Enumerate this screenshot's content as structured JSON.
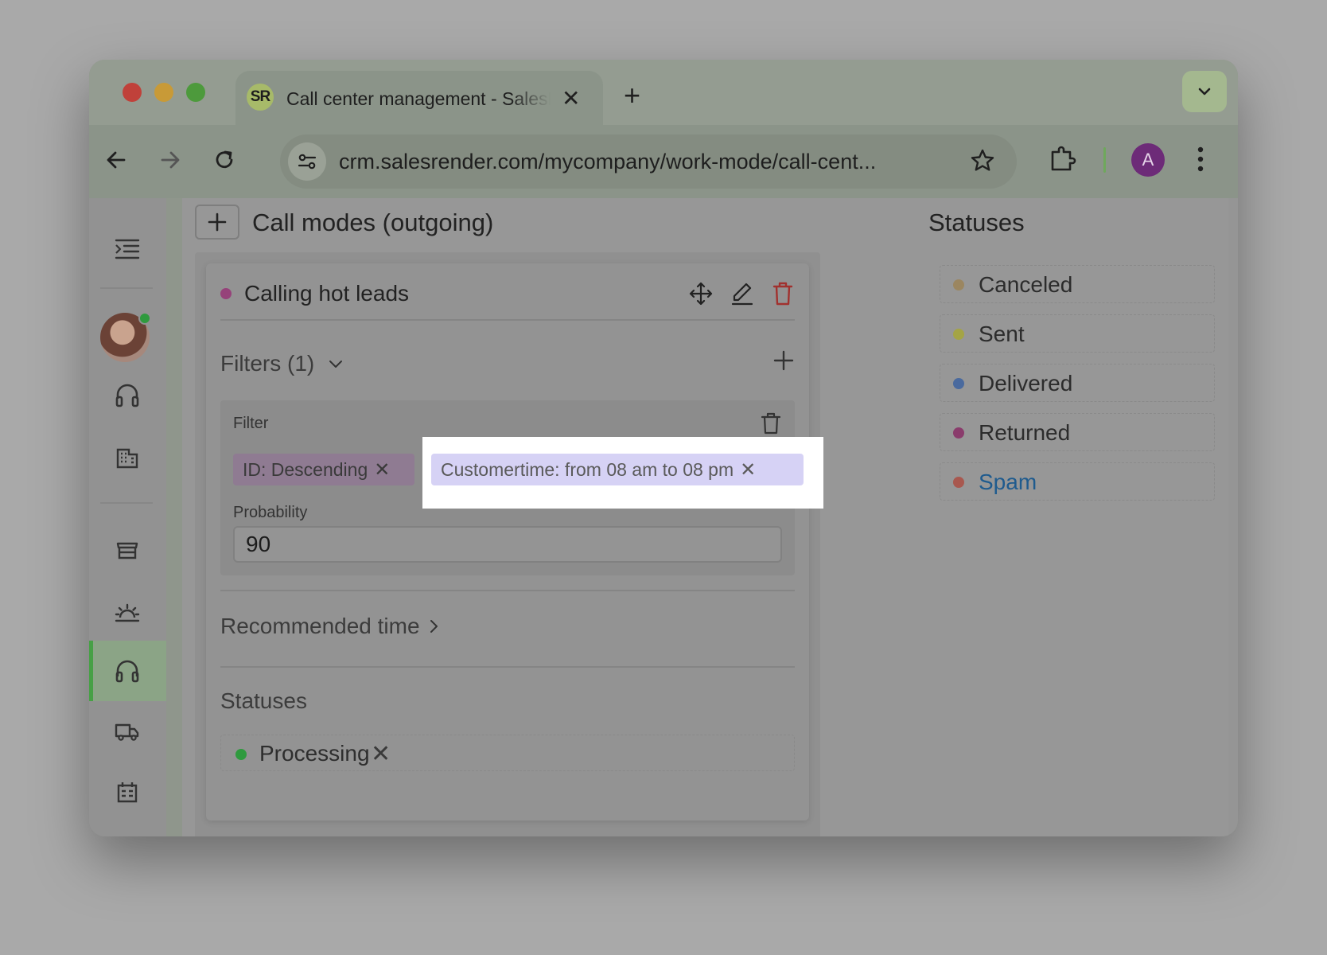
{
  "browser": {
    "tab_title": "Call center management - SalesRender",
    "favicon_text": "SR",
    "tab_close": "✕",
    "new_tab": "+",
    "url": "crm.salesrender.com/mycompany/work-mode/call-cent...",
    "profile_initial": "A",
    "colors": {
      "profile": "#6d2b78",
      "separator": "#6fa85c"
    }
  },
  "sidebar": {
    "icons": [
      "menu-collapse-icon",
      "avatar",
      "headset-icon",
      "building-icon",
      "store-icon",
      "sunset-icon",
      "headphones-icon",
      "truck-icon",
      "calendar-building-icon"
    ],
    "active_item": "headphones-icon",
    "colors": {
      "active": "#47a046",
      "online": "#2f9a3e"
    }
  },
  "section": {
    "add_label": "+",
    "title": "Call modes (outgoing)"
  },
  "card": {
    "title": "Calling hot leads",
    "filters_label": "Filters (1)",
    "filter": {
      "label": "Filter",
      "tags": [
        {
          "text": "ID: Descending",
          "remove": "✕"
        },
        {
          "text": "Customertime: from 08 am to 08 pm",
          "remove": "✕"
        }
      ],
      "probability_label": "Probability",
      "probability_value": "90"
    },
    "recommended_time_label": "Recommended time",
    "statuses_label": "Statuses",
    "statuses": [
      {
        "name": "Processing",
        "color": "#2f9a3e",
        "remove": "✕"
      }
    ]
  },
  "statuses_panel": {
    "title": "Statuses",
    "items": [
      {
        "name": "Canceled",
        "color": "#9b8660"
      },
      {
        "name": "Sent",
        "color": "#a4a445"
      },
      {
        "name": "Delivered",
        "color": "#4a6a9e"
      },
      {
        "name": "Returned",
        "color": "#8a3c6c"
      },
      {
        "name": "Spam",
        "color": "#a8584f"
      }
    ]
  }
}
